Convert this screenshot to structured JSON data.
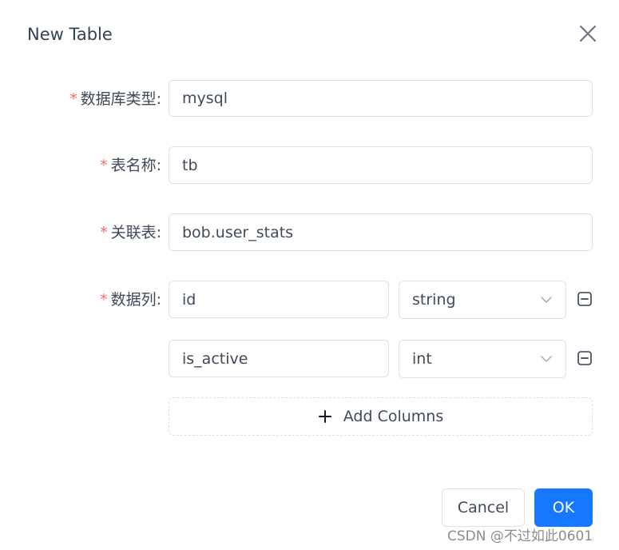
{
  "dialog": {
    "title": "New Table",
    "close_icon": "close-icon"
  },
  "form": {
    "db_type": {
      "required_mark": "*",
      "label": "数据库类型:",
      "value": "mysql"
    },
    "table_name": {
      "required_mark": "*",
      "label": "表名称:",
      "value": "tb"
    },
    "related_table": {
      "required_mark": "*",
      "label": "关联表:",
      "value": "bob.user_stats"
    },
    "columns": {
      "required_mark": "*",
      "label": "数据列:",
      "items": [
        {
          "name": "id",
          "type": "string"
        },
        {
          "name": "is_active",
          "type": "int"
        }
      ],
      "add_label": "Add Columns"
    }
  },
  "footer": {
    "cancel_label": "Cancel",
    "ok_label": "OK"
  },
  "watermark": "CSDN @不过如此0601",
  "colors": {
    "primary": "#1677ff",
    "required": "#f56c6c",
    "border": "#dcdfe6",
    "text": "#3f4a5a"
  }
}
